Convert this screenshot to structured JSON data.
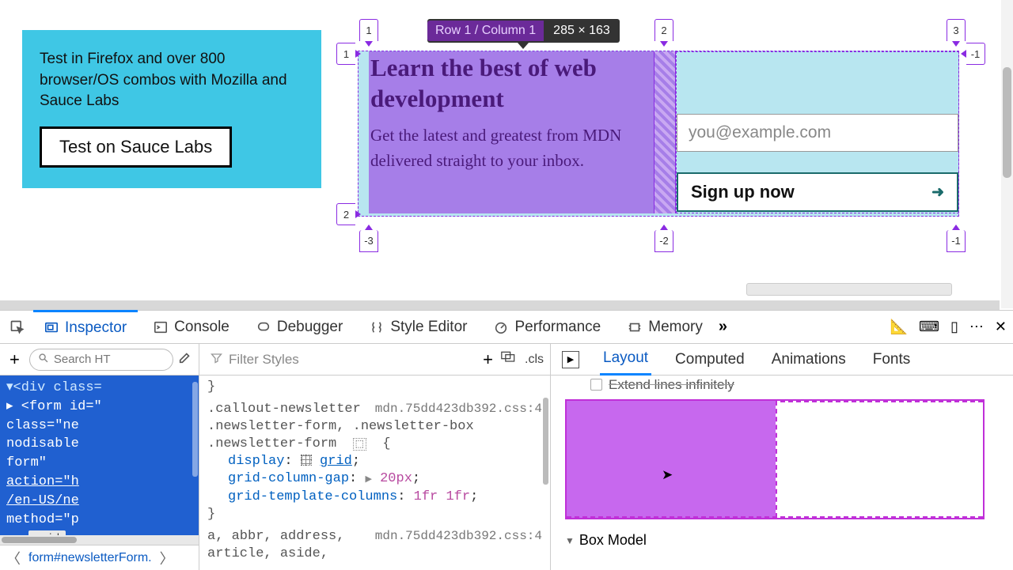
{
  "page": {
    "callout_text": "Test in Firefox and over 800 browser/OS combos with Mozilla and Sauce Labs",
    "callout_button": "Test on Sauce Labs",
    "newsletter_heading": "Learn the best of web development",
    "newsletter_body": "Get the latest and greatest from MDN delivered straight to your inbox.",
    "email_placeholder": "you@example.com",
    "signup_button": "Sign up now"
  },
  "overlay": {
    "tooltip_label": "Row 1 / Column 1",
    "tooltip_dims": "285 × 163",
    "top_markers": [
      "1",
      "2",
      "3"
    ],
    "left_markers": [
      "1",
      "2"
    ],
    "right_markers": [
      "-1"
    ],
    "bottom_markers": [
      "-3",
      "-2",
      "-1"
    ]
  },
  "devtools": {
    "tabs": [
      "Inspector",
      "Console",
      "Debugger",
      "Style Editor",
      "Performance",
      "Memory"
    ],
    "html_search_placeholder": "Search HT",
    "styles_filter_placeholder": "Filter Styles",
    "cls_label": ".cls",
    "breadcrumb": "form#newsletterForm.",
    "grid_badge": "grid",
    "layout_tabs": [
      "Layout",
      "Computed",
      "Animations",
      "Fonts"
    ],
    "extend_label": "Extend lines infinitely",
    "box_model_label": "Box Model",
    "html_tree": {
      "l0": "▾<div class=",
      "l1": " ▸ <form id=\"",
      "l2": "   class=\"ne",
      "l3": "   nodisable",
      "l4": "   form\"",
      "l5": "   action=\"h",
      "l6": "   /en-US/ne",
      "l7": "   method=\"p"
    },
    "rules": {
      "r1_brace": "}",
      "r2_src": "mdn.75dd423db392.css:4",
      "r2_sel1": ".callout-newsletter",
      "r2_sel2": ".newsletter-form, .newsletter-box",
      "r2_sel3": ".newsletter-form",
      "r2_open": "{",
      "d1_prop": "display",
      "d1_val": "grid",
      "d2_prop": "grid-column-gap",
      "d2_val": "20px",
      "d3_prop": "grid-template-columns",
      "d3_val": "1fr 1fr",
      "r2_close": "}",
      "r3_src": "mdn.75dd423db392.css:4",
      "r3_sel": "a, abbr, address, article, aside,"
    }
  }
}
